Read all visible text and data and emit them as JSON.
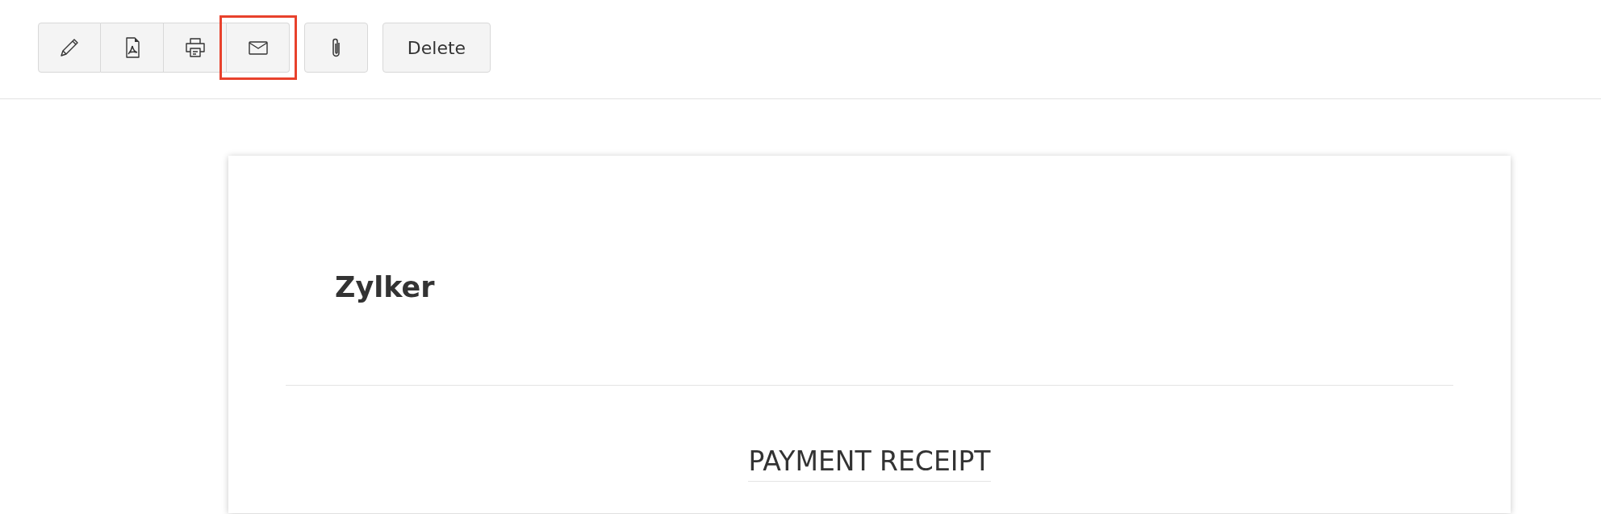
{
  "toolbar": {
    "icon_buttons": [
      {
        "highlighted": false
      },
      {
        "highlighted": false
      },
      {
        "highlighted": false
      },
      {
        "highlighted": true
      }
    ],
    "delete_button": {
      "label": "Delete"
    }
  },
  "receipt": {
    "company": "Zylker",
    "title": "PAYMENT RECEIPT"
  }
}
